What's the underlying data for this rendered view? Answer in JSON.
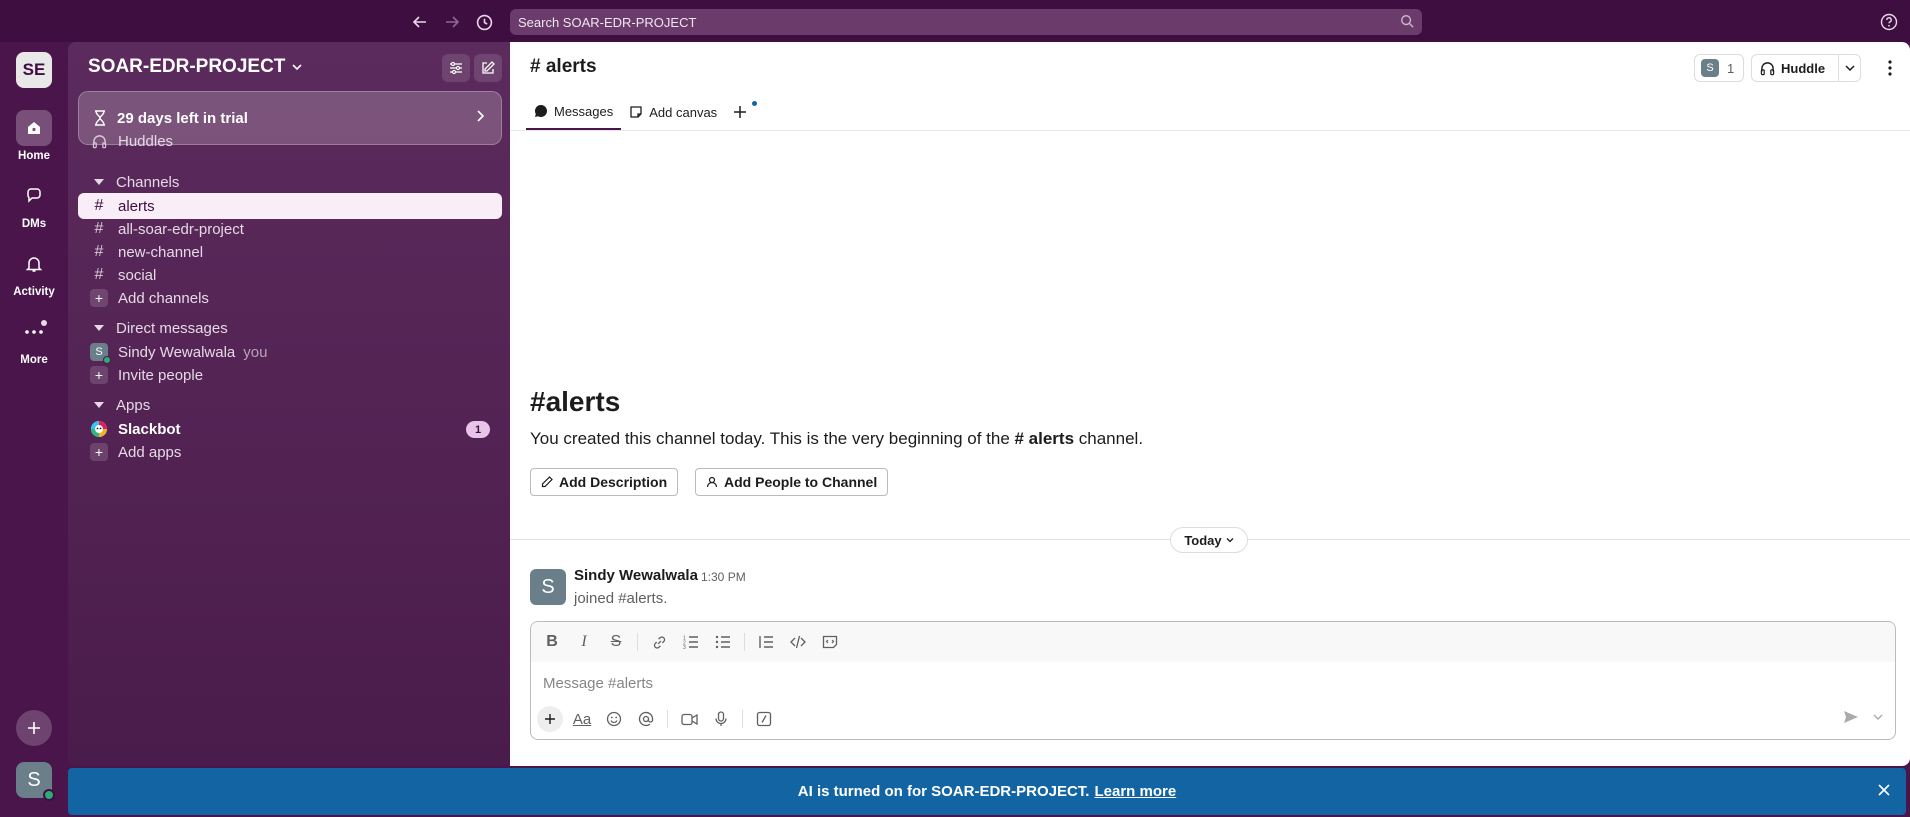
{
  "search": {
    "placeholder": "Search SOAR-EDR-PROJECT"
  },
  "workspace": {
    "initials": "SE",
    "name": "SOAR-EDR-PROJECT"
  },
  "rail": {
    "items": [
      {
        "label": "Home",
        "icon": "home-icon"
      },
      {
        "label": "DMs",
        "icon": "dms-icon"
      },
      {
        "label": "Activity",
        "icon": "bell-icon"
      },
      {
        "label": "More",
        "icon": "more-icon"
      }
    ],
    "user_initial": "S"
  },
  "sidebar": {
    "trial": "29 days left in trial",
    "huddles": "Huddles",
    "channels_header": "Channels",
    "channels": [
      "alerts",
      "all-soar-edr-project",
      "new-channel",
      "social"
    ],
    "add_channels": "Add channels",
    "dm_header": "Direct messages",
    "dm_user": "Sindy Wewalwala",
    "dm_user_initial": "S",
    "you_label": "you",
    "invite": "Invite people",
    "apps_header": "Apps",
    "slackbot": "Slackbot",
    "slackbot_badge": "1",
    "add_apps": "Add apps"
  },
  "channel": {
    "title": "# alerts",
    "member_initial": "S",
    "member_count": "1",
    "huddle_label": "Huddle",
    "tabs": {
      "messages": "Messages",
      "add_canvas": "Add canvas"
    },
    "intro_hash": "#",
    "intro_name": "alerts",
    "intro_text_before": "You created this channel today. This is the very beginning of the ",
    "intro_channel": "# alerts",
    "intro_text_after": " channel.",
    "add_description": "Add Description",
    "add_people": "Add People to Channel",
    "day_label": "Today"
  },
  "message": {
    "avatar_initial": "S",
    "author": "Sindy Wewalwala",
    "time": "1:30 PM",
    "text": "joined #alerts."
  },
  "composer": {
    "placeholder": "Message #alerts",
    "text_format_label": "Aa"
  },
  "banner": {
    "text": "AI is turned on for SOAR-EDR-PROJECT.",
    "link": "Learn more"
  },
  "colors": {
    "aubergine": "#4a154b",
    "active_row": "#f9edf7",
    "banner_blue": "#1264a3",
    "online": "#2bac76"
  }
}
